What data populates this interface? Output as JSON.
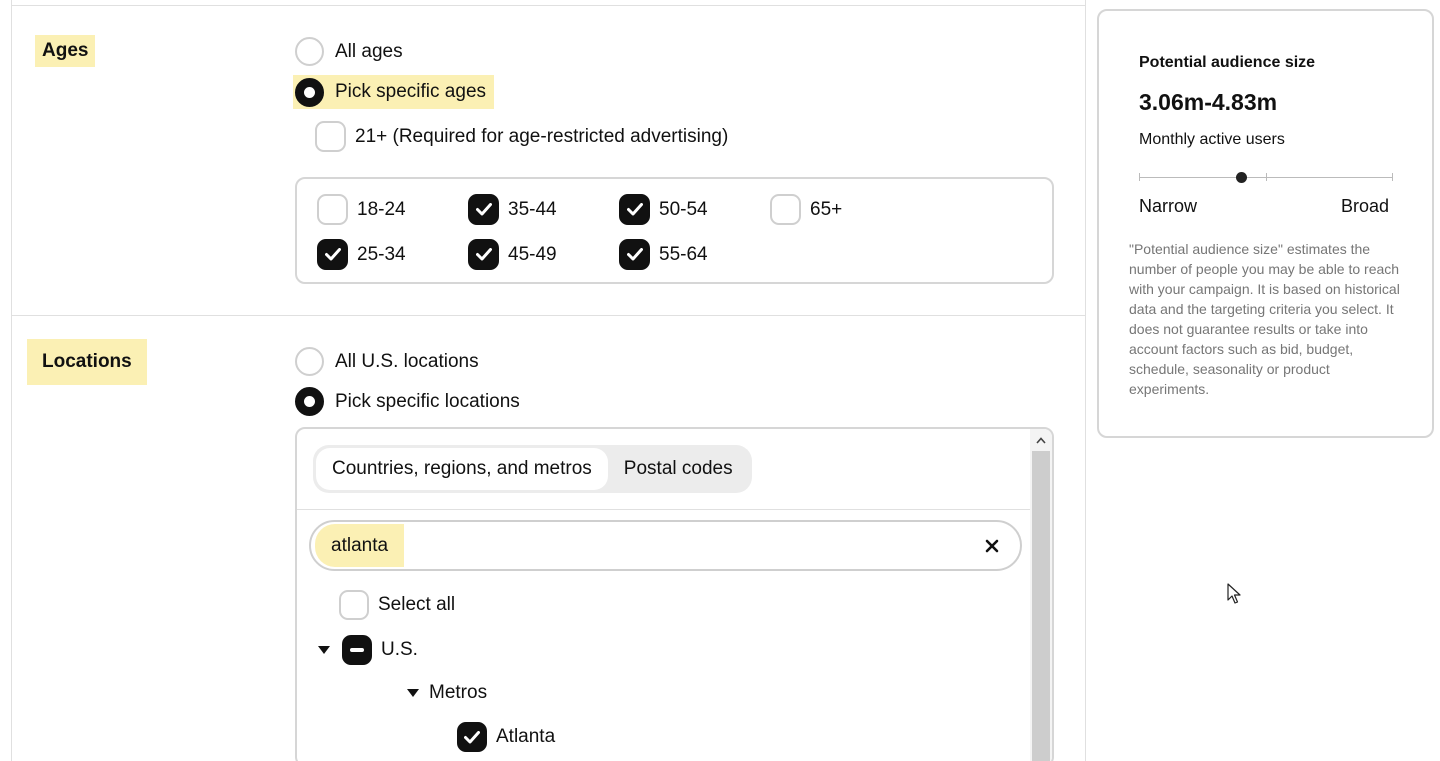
{
  "ages": {
    "label": "Ages",
    "options": [
      {
        "label": "All ages",
        "selected": false
      },
      {
        "label": "Pick specific ages",
        "selected": true
      }
    ],
    "restricted": {
      "label": "21+ (Required for age-restricted advertising)",
      "checked": false
    },
    "ranges": [
      {
        "label": "18-24",
        "checked": false
      },
      {
        "label": "25-34",
        "checked": true
      },
      {
        "label": "35-44",
        "checked": true
      },
      {
        "label": "45-49",
        "checked": true
      },
      {
        "label": "50-54",
        "checked": true
      },
      {
        "label": "55-64",
        "checked": true
      },
      {
        "label": "65+",
        "checked": false
      }
    ]
  },
  "locations": {
    "label": "Locations",
    "options": [
      {
        "label": "All U.S. locations",
        "selected": false
      },
      {
        "label": "Pick specific locations",
        "selected": true
      }
    ],
    "tabs": [
      {
        "label": "Countries, regions, and metros",
        "active": true
      },
      {
        "label": "Postal codes",
        "active": false
      }
    ],
    "search": {
      "value": "atlanta"
    },
    "select_all": "Select all",
    "tree": {
      "country": "U.S.",
      "group": "Metros",
      "item": "Atlanta"
    }
  },
  "audience": {
    "title": "Potential audience size",
    "size": "3.06m-4.83m",
    "subtitle": "Monthly active users",
    "slider_level": 0.4,
    "narrow_label": "Narrow",
    "broad_label": "Broad",
    "note": "\"Potential audience size\" estimates the number of people you may be able to reach with your campaign. It is based on historical data and the targeting criteria you select. It does not guarantee results or take into account factors such as bid, budget, schedule, seasonality or product experiments."
  },
  "colors": {
    "highlight": "#fbf0b4",
    "checked": "#111111",
    "border": "#d6d6d6"
  }
}
